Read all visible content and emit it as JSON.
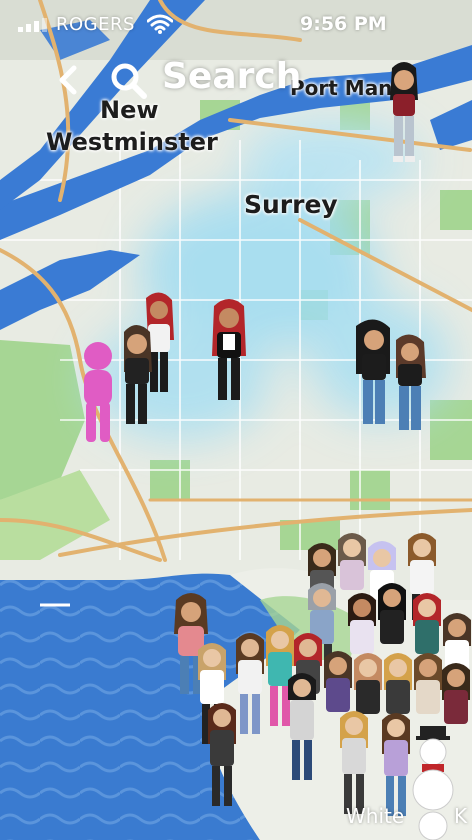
{
  "status_bar": {
    "carrier": "ROGERS",
    "time": "9:56 PM"
  },
  "search": {
    "label": "Search"
  },
  "places": {
    "port_mann": "Port Mann",
    "new_westminster_1": "New",
    "new_westminster_2": "Westminster",
    "surrey": "Surrey"
  },
  "bottom_labels": {
    "left": "White",
    "right": "K"
  },
  "colors": {
    "water": "#3e7fd0",
    "land": "#e9ece4",
    "park": "#9cd28a",
    "heat": "#8fd8f0",
    "self_avatar": "#e05cc4",
    "road_major": "#e0b06e"
  },
  "icons": [
    "signal-icon",
    "wifi-icon",
    "back-chevron-icon",
    "search-icon"
  ]
}
